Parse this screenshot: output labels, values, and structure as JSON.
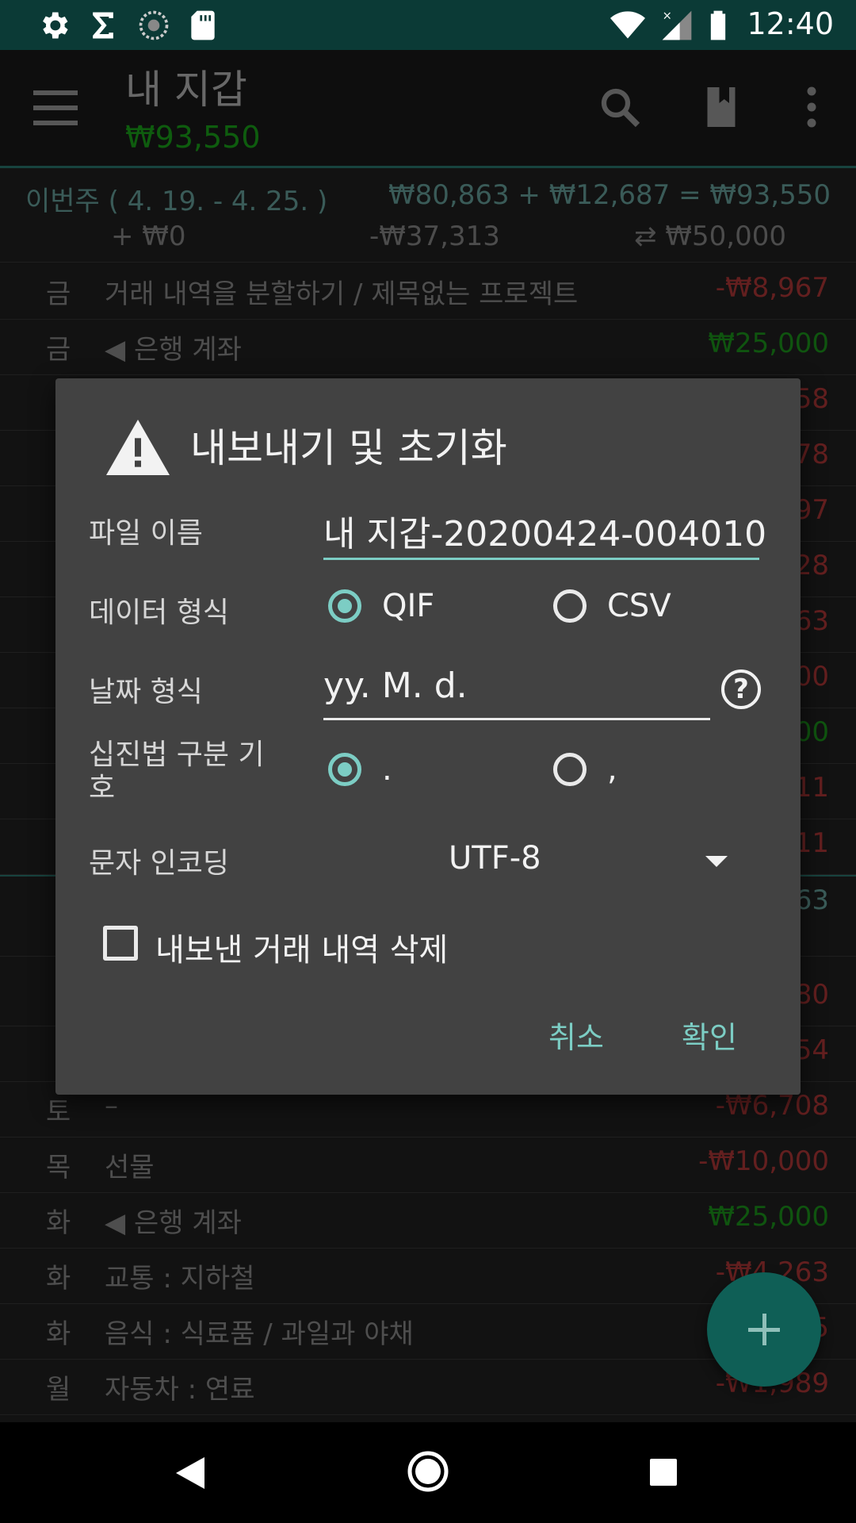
{
  "status_bar": {
    "time": "12:40",
    "icons": [
      "gear-icon",
      "sigma-icon",
      "sync-icon",
      "sd-card-icon",
      "wifi-icon",
      "signal-icon",
      "battery-icon"
    ]
  },
  "app_bar": {
    "title": "내 지갑",
    "balance": "₩93,550",
    "icons": [
      "menu-icon",
      "search-icon",
      "book-icon",
      "more-vert-icon"
    ]
  },
  "week_summary": {
    "range": "이번주 ( 4. 19. -  4. 25. )",
    "total": "₩80,863 + ₩12,687 = ₩93,550",
    "income": "+ ₩0",
    "expense": "-₩37,313",
    "transfer": "⇄ ₩50,000"
  },
  "transactions_top": [
    {
      "day": "금",
      "desc": "거래 내역을 분할하기 / 제목없는 프로젝트",
      "amount": "-₩8,967",
      "sign": "neg"
    },
    {
      "day": "금",
      "desc": "◀ 은행 계좌",
      "amount": "₩25,000",
      "sign": "pos"
    }
  ],
  "partial_amounts": [
    "58",
    "78",
    "97",
    "28",
    "63",
    "00",
    "00",
    "11",
    "11",
    "63",
    "80",
    "54"
  ],
  "transactions_bottom": [
    {
      "day": "토",
      "desc": "–",
      "amount": "-₩6,708",
      "sign": "neg"
    },
    {
      "day": "목",
      "desc": "선물",
      "amount": "-₩10,000",
      "sign": "neg"
    },
    {
      "day": "화",
      "desc": "◀ 은행 계좌",
      "amount": "₩25,000",
      "sign": "pos"
    },
    {
      "day": "화",
      "desc": "교통 : 지하철",
      "amount": "-₩4,263",
      "sign": "neg"
    },
    {
      "day": "화",
      "desc": "음식 : 식료품 / 과일과 야채",
      "amount": "5",
      "sign": "neg"
    },
    {
      "day": "월",
      "desc": "자동차 : 연료",
      "amount": "-₩1,989",
      "sign": "neg"
    }
  ],
  "dialog": {
    "title": "내보내기 및 초기화",
    "file_name_label": "파일 이름",
    "file_name_value": "내 지갑-20200424-004010",
    "data_format_label": "데이터 형식",
    "data_format_options": [
      "QIF",
      "CSV"
    ],
    "data_format_selected": "QIF",
    "date_format_label": "날짜 형식",
    "date_format_value": "yy. M. d.",
    "decimal_label": "십진법 구분 기호",
    "decimal_options": [
      ".",
      ","
    ],
    "decimal_selected": ".",
    "encoding_label": "문자 인코딩",
    "encoding_value": "UTF-8",
    "delete_label": "내보낸 거래 내역 삭제",
    "delete_checked": false,
    "cancel": "취소",
    "ok": "확인"
  },
  "fab": {
    "icon": "plus-icon"
  },
  "nav_bar": {
    "icons": [
      "back-icon",
      "home-icon",
      "recents-icon"
    ]
  },
  "colors": {
    "accent": "#7ccdc4",
    "positive": "#1c9a1c",
    "negative": "#b53a3a",
    "status_bar": "#0b3a36"
  }
}
